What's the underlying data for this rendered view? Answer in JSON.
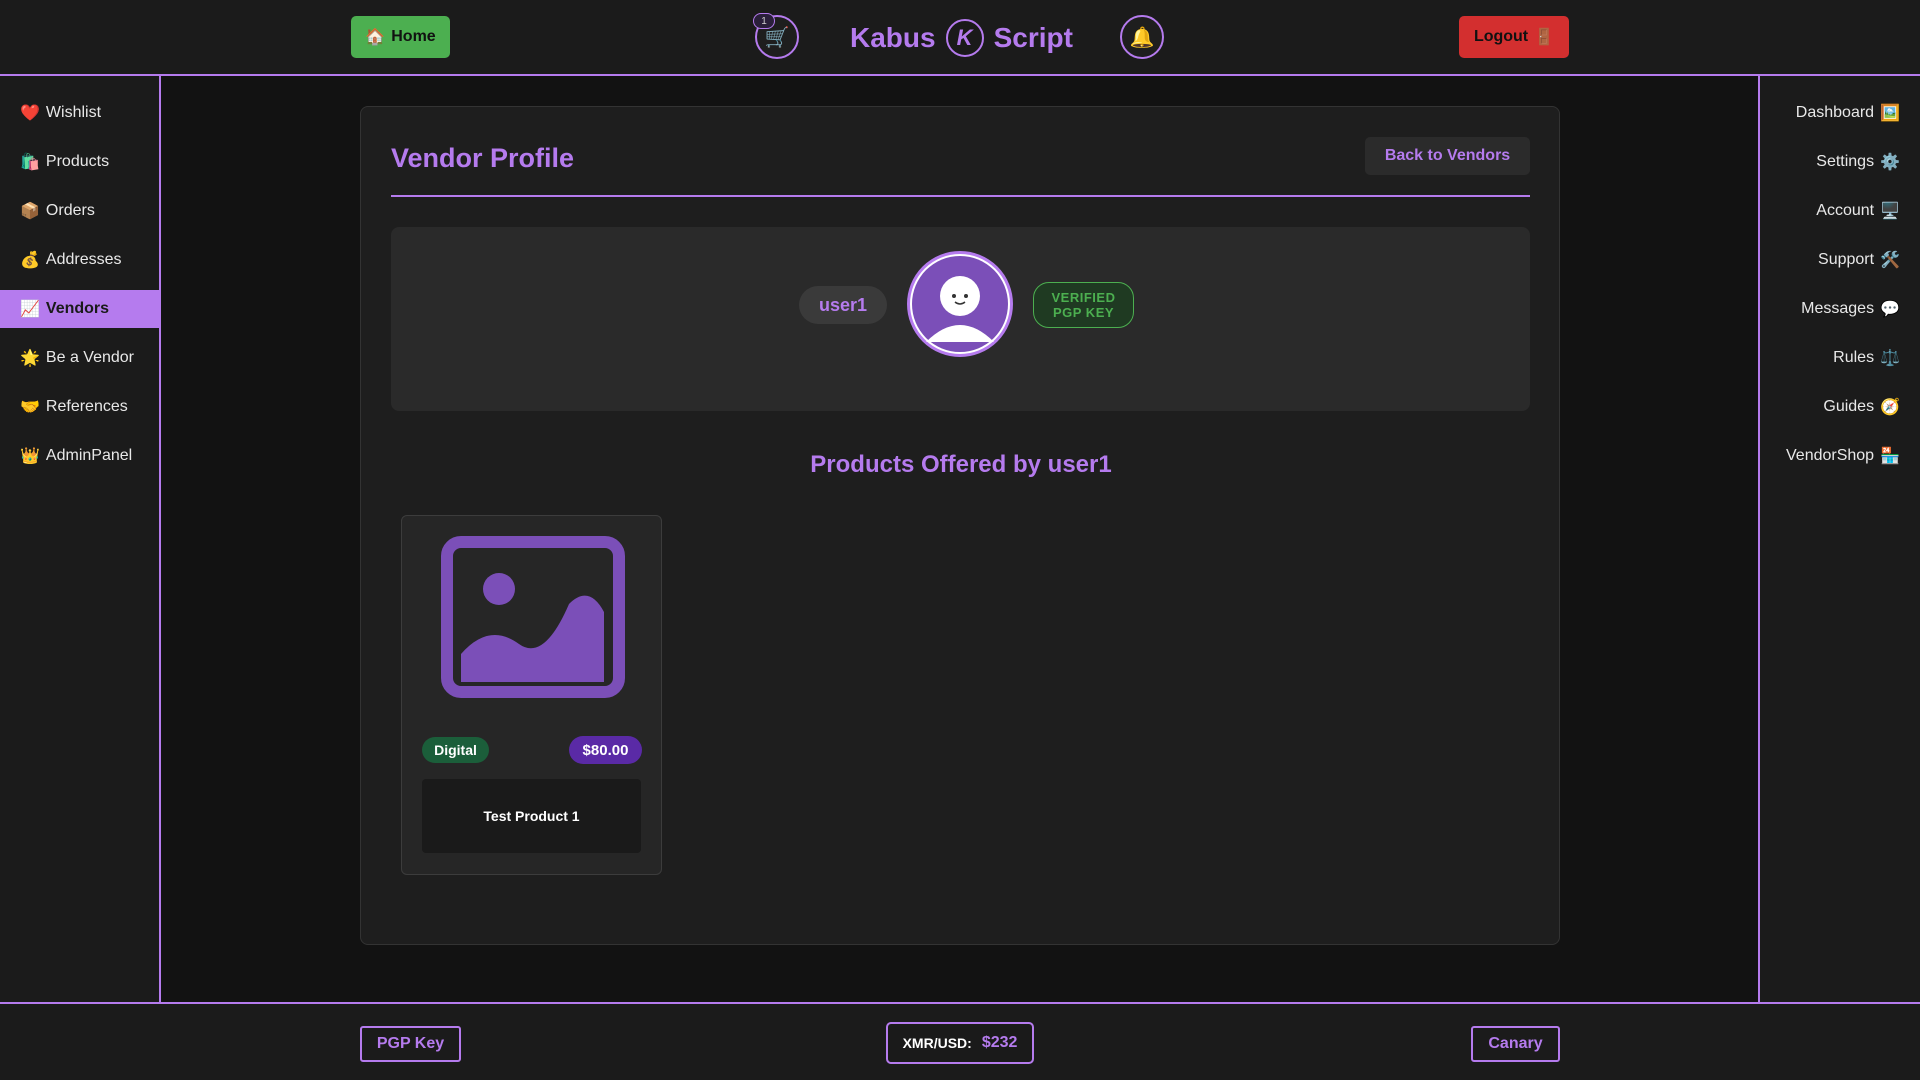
{
  "header": {
    "home": {
      "icon": "🏠",
      "label": "Home"
    },
    "cart": {
      "icon": "🛒",
      "count": "1"
    },
    "brand": {
      "left": "Kabus",
      "logo": "K",
      "right": "Script"
    },
    "bell": {
      "icon": "🔔"
    },
    "logout": {
      "label": "Logout",
      "icon": "🚪"
    }
  },
  "left_nav": {
    "items": [
      {
        "icon": "❤️",
        "label": "Wishlist"
      },
      {
        "icon": "🛍️",
        "label": "Products"
      },
      {
        "icon": "📦",
        "label": "Orders"
      },
      {
        "icon": "💰",
        "label": "Addresses"
      },
      {
        "icon": "📈",
        "label": "Vendors"
      },
      {
        "icon": "🌟",
        "label": "Be a Vendor"
      },
      {
        "icon": "🤝",
        "label": "References"
      },
      {
        "icon": "👑",
        "label": "AdminPanel"
      }
    ],
    "active": "Vendors"
  },
  "right_nav": {
    "items": [
      {
        "label": "Dashboard",
        "icon": "🖼️"
      },
      {
        "label": "Settings",
        "icon": "⚙️"
      },
      {
        "label": "Account",
        "icon": "🖥️"
      },
      {
        "label": "Support",
        "icon": "🛠️"
      },
      {
        "label": "Messages",
        "icon": "💬"
      },
      {
        "label": "Rules",
        "icon": "⚖️"
      },
      {
        "label": "Guides",
        "icon": "🧭"
      },
      {
        "label": "VendorShop",
        "icon": "🏪"
      }
    ]
  },
  "main": {
    "title": "Vendor Profile",
    "back_button": "Back to Vendors",
    "profile": {
      "username": "user1",
      "verified_line1": "VERIFIED",
      "verified_line2": "PGP KEY"
    },
    "products_heading": "Products Offered by user1",
    "products": [
      {
        "category": "Digital",
        "price": "$80.00",
        "name": "Test Product 1"
      }
    ]
  },
  "footer": {
    "pgp_key": "PGP Key",
    "rate_label": "XMR/USD:",
    "rate_value": "$232",
    "canary": "Canary"
  },
  "colors": {
    "accent": "#b57bee",
    "success": "#4caf50",
    "danger": "#d32f2f",
    "background": "#121212",
    "panel": "#1e1e1e"
  }
}
